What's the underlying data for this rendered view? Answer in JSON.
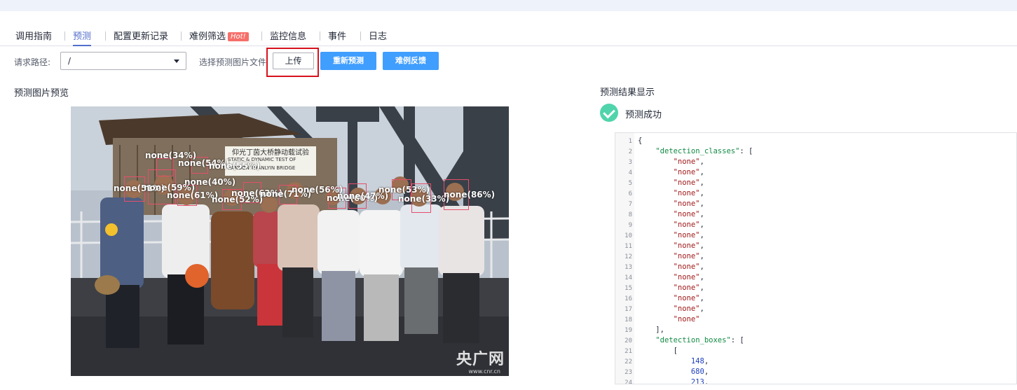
{
  "tabs": [
    {
      "label": "调用指南",
      "active": false
    },
    {
      "label": "预测",
      "active": true
    },
    {
      "label": "配置更新记录",
      "active": false
    },
    {
      "label": "难例筛选",
      "active": false,
      "badge": "Hot!"
    },
    {
      "label": "监控信息",
      "active": false
    },
    {
      "label": "事件",
      "active": false
    },
    {
      "label": "日志",
      "active": false
    }
  ],
  "toolbar": {
    "path_label": "请求路径:",
    "path_value": "/",
    "file_label": "选择预测图片文件",
    "upload_label": "上传",
    "repredict_label": "重新预测",
    "feedback_label": "难例反馈"
  },
  "preview": {
    "title": "预测图片预览",
    "sign_text": "仰光丁茵大桥静动载试验",
    "sign_text_en": "STATIC & DYNAMIC TEST OF",
    "sign_text_en2": "RANGON THANLYIN BRIDGE",
    "watermark": "央广网",
    "watermark_sub": "www.cnr.cn",
    "detections": [
      {
        "label": "none(34%)"
      },
      {
        "label": "none(54%)"
      },
      {
        "label": "none(55%)"
      },
      {
        "label": "none(40%)"
      },
      {
        "label": "none(51%)"
      },
      {
        "label": "none(59%)"
      },
      {
        "label": "none(61%)"
      },
      {
        "label": "none(52%)"
      },
      {
        "label": "none(63%)"
      },
      {
        "label": "none(71%)"
      },
      {
        "label": "none(56%)"
      },
      {
        "label": "none(60%)"
      },
      {
        "label": "none(47%)"
      },
      {
        "label": "none(53%)"
      },
      {
        "label": "none(33%)"
      },
      {
        "label": "none(86%)"
      }
    ]
  },
  "result": {
    "title": "预测结果显示",
    "status": "预测成功",
    "code_lines": [
      {
        "n": "1",
        "t": "{"
      },
      {
        "n": "2",
        "t": "    \"detection_classes\": ["
      },
      {
        "n": "3",
        "t": "        \"none\","
      },
      {
        "n": "4",
        "t": "        \"none\","
      },
      {
        "n": "5",
        "t": "        \"none\","
      },
      {
        "n": "6",
        "t": "        \"none\","
      },
      {
        "n": "7",
        "t": "        \"none\","
      },
      {
        "n": "8",
        "t": "        \"none\","
      },
      {
        "n": "9",
        "t": "        \"none\","
      },
      {
        "n": "10",
        "t": "        \"none\","
      },
      {
        "n": "11",
        "t": "        \"none\","
      },
      {
        "n": "12",
        "t": "        \"none\","
      },
      {
        "n": "13",
        "t": "        \"none\","
      },
      {
        "n": "14",
        "t": "        \"none\","
      },
      {
        "n": "15",
        "t": "        \"none\","
      },
      {
        "n": "16",
        "t": "        \"none\","
      },
      {
        "n": "17",
        "t": "        \"none\","
      },
      {
        "n": "18",
        "t": "        \"none\""
      },
      {
        "n": "19",
        "t": "    ],"
      },
      {
        "n": "20",
        "t": "    \"detection_boxes\": ["
      },
      {
        "n": "21",
        "t": "        ["
      },
      {
        "n": "22",
        "t": "            148,"
      },
      {
        "n": "23",
        "t": "            680,"
      },
      {
        "n": "24",
        "t": "            213,"
      }
    ]
  },
  "colors": {
    "accent": "#526ecc",
    "primary_button": "#409eff",
    "success": "#50d4ab",
    "highlight": "#d7121d",
    "detection_box": "#e44f6b"
  }
}
